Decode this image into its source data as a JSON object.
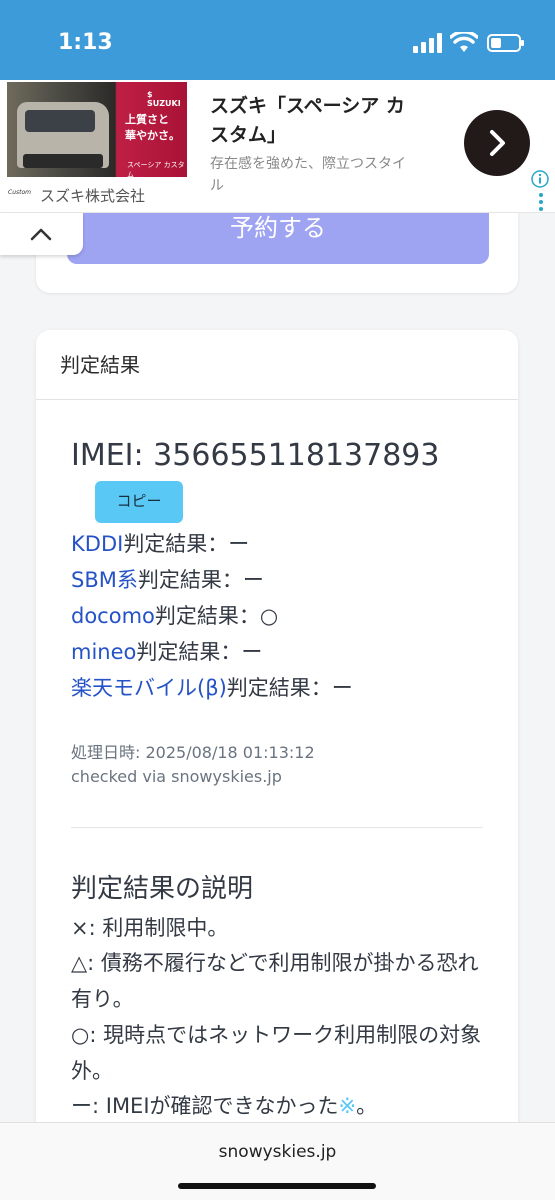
{
  "status_bar": {
    "time": "1:13"
  },
  "ad": {
    "brand_logo": "$ SUZUKI",
    "catch_line1": "上質さと",
    "catch_line2": "華やかさ。",
    "product_label": "スペーシア カスタム",
    "mini_logo": "Custom",
    "advertiser": "スズキ株式会社",
    "title": "スズキ「スペーシア カスタム」",
    "description": "存在感を強めた、際立つスタイル",
    "icons": [
      "chevron-right-icon",
      "info-icon",
      "more-vertical-icon",
      "chevron-up-icon"
    ]
  },
  "reserve_button": {
    "label": "予約する"
  },
  "result_card": {
    "header": "判定結果",
    "imei": "IMEI: 356655118137893",
    "copy_label": "コピー",
    "results": [
      {
        "carrier": "KDDI",
        "suffix": "判定結果：ー"
      },
      {
        "carrier": "SBM系",
        "suffix": "判定結果：ー"
      },
      {
        "carrier": "docomo",
        "suffix": "判定結果：○"
      },
      {
        "carrier": "mineo",
        "suffix": "判定結果：ー"
      },
      {
        "carrier": "楽天モバイル(β)",
        "suffix": "判定結果：ー"
      }
    ],
    "processed": "処理日時: 2025/08/18 01:13:12",
    "checked_via": "checked via snowyskies.jp",
    "explain_title": "判定結果の説明",
    "explain": {
      "cross": "×: 利用制限中。",
      "triangle": "△: 債務不履行などで利用制限が掛かる恐れ有り。",
      "circle": "○: 現時点ではネットワーク利用制限の対象外。",
      "dash_before": "ー: IMEIが確認できなかった",
      "dash_note": "※",
      "dash_after": "。"
    }
  },
  "url_bar": {
    "url": "snowyskies.jp"
  }
}
